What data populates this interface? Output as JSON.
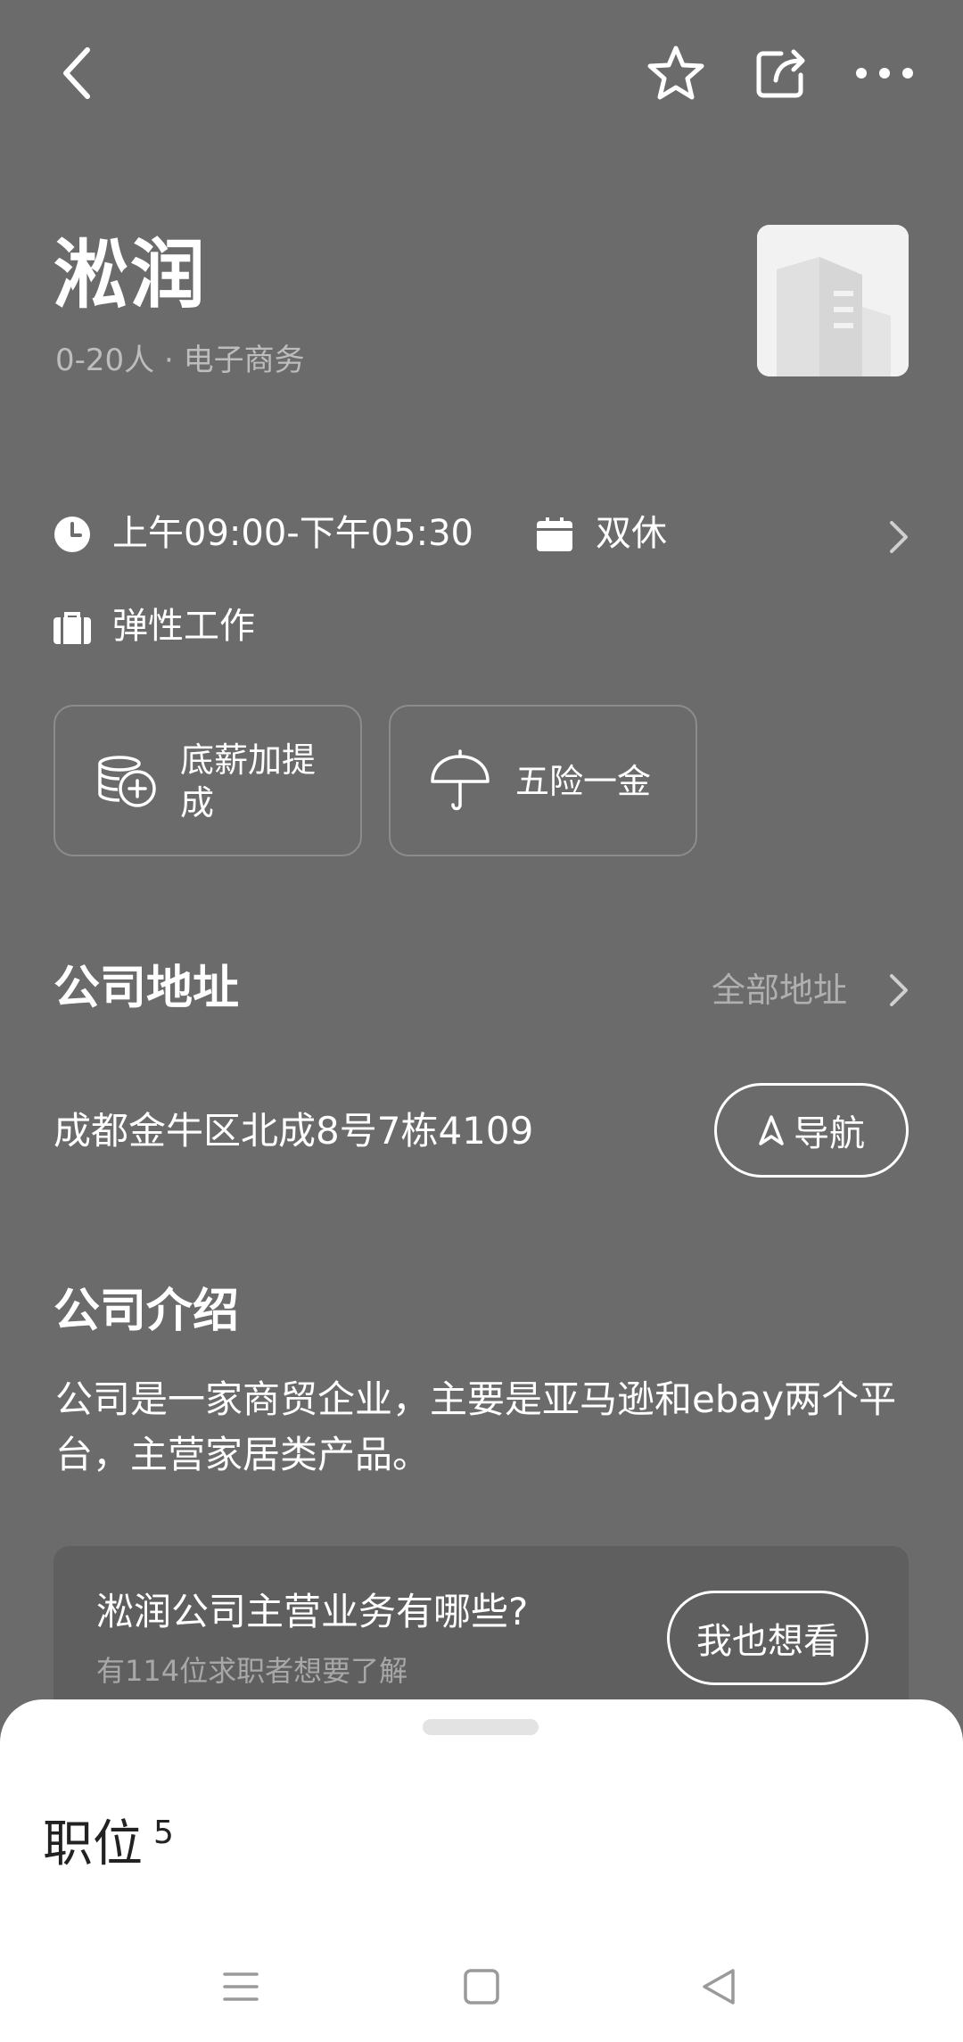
{
  "topbar": {
    "back_icon": "back-arrow-icon",
    "favorite_icon": "star-outline-icon",
    "share_icon": "share-icon",
    "more_icon": "more-dots-icon"
  },
  "company": {
    "name": "淞润",
    "meta": "0-20人 · 电子商务",
    "logo_icon": "building-placeholder-icon"
  },
  "work_info": {
    "hours": "上午09:00-下午05:30",
    "rest": "双休",
    "work_type": "弹性工作"
  },
  "benefits": [
    {
      "label": "底薪加提成",
      "icon": "coins-plus-icon"
    },
    {
      "label": "五险一金",
      "icon": "umbrella-icon"
    }
  ],
  "address_section": {
    "title": "公司地址",
    "all_link": "全部地址",
    "address": "成都金牛区北成8号7栋4109",
    "nav_button": "导航"
  },
  "intro_section": {
    "title": "公司介绍",
    "text": "公司是一家商贸企业，主要是亚马逊和ebay两个平台，主营家居类产品。"
  },
  "qa_card": {
    "question": "淞润公司主营业务有哪些?",
    "sub": "有114位求职者想要了解",
    "button": "我也想看"
  },
  "jobs_sheet": {
    "label": "职位",
    "count": "5"
  },
  "colors": {
    "background": "#6b6b6b",
    "sheet": "#ffffff",
    "muted_text": "#b0b0b0"
  }
}
